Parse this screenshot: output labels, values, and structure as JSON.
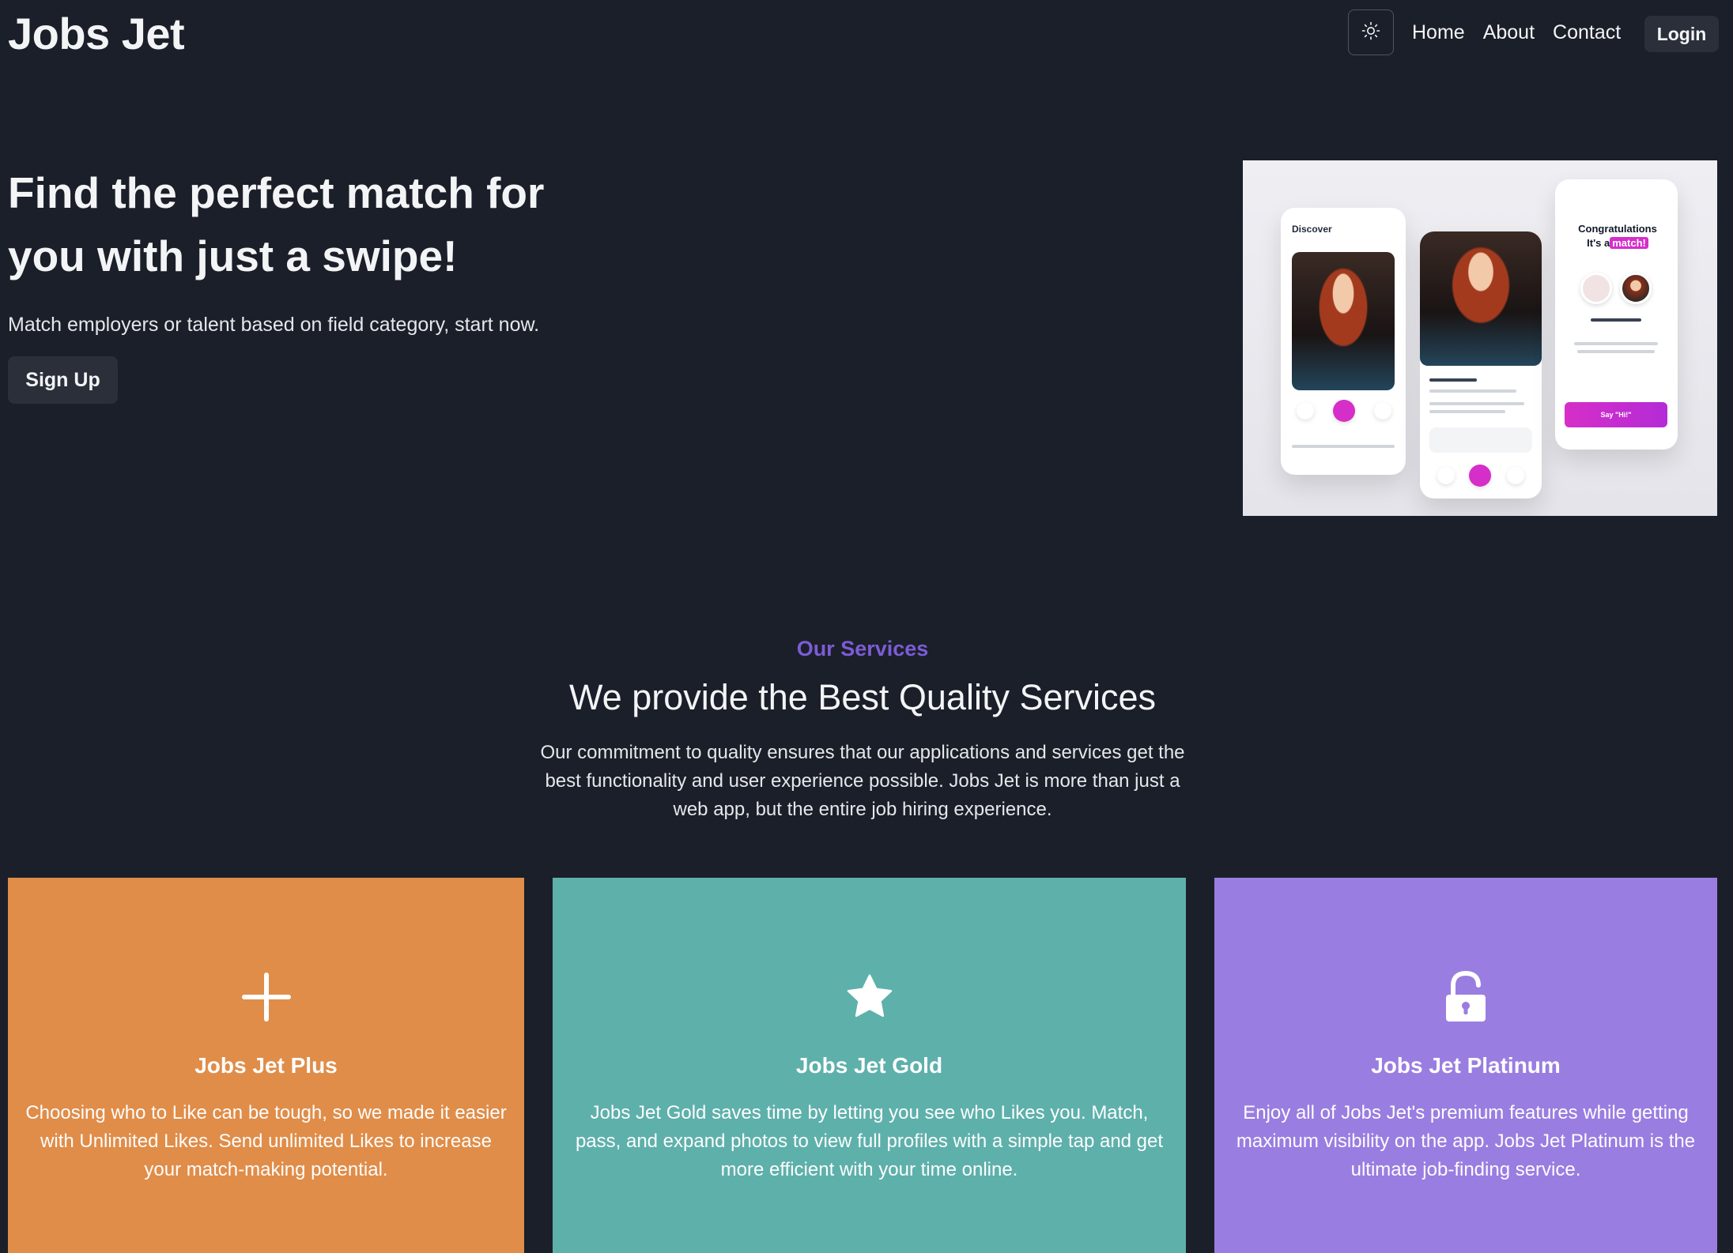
{
  "header": {
    "brand": "Jobs Jet",
    "theme_toggle_icon": "sun-icon",
    "nav": [
      {
        "label": "Home"
      },
      {
        "label": "About"
      },
      {
        "label": "Contact"
      }
    ],
    "login_label": "Login"
  },
  "hero": {
    "title": "Find the perfect match for you with just a swipe!",
    "subtitle": "Match employers or talent based on field category, start now.",
    "signup_label": "Sign Up",
    "image": {
      "phone1_heading": "Discover",
      "congrats_line1": "Congratulations",
      "congrats_line2_prefix": "It's a",
      "congrats_match": "match!",
      "say_hi": "Say \"Hi!\"",
      "accent_color": "#d62ec9"
    }
  },
  "services": {
    "eyebrow": "Our Services",
    "title": "We provide the Best Quality Services",
    "description": "Our commitment to quality ensures that our applications and services get the best functionality and user experience possible. Jobs Jet is more than just a web app, but the entire job hiring experience.",
    "cards": [
      {
        "title": "Jobs Jet Plus",
        "icon": "plus-icon",
        "color": "#e08d49",
        "description": "Choosing who to Like can be tough, so we made it easier with Unlimited Likes. Send unlimited Likes to increase your match-making potential."
      },
      {
        "title": "Jobs Jet Gold",
        "icon": "star-icon",
        "color": "#5eb0ab",
        "description": "Jobs Jet Gold saves time by letting you see who Likes you. Match, pass, and expand photos to view full profiles with a simple tap and get more efficient with your time online."
      },
      {
        "title": "Jobs Jet Platinum",
        "icon": "unlock-icon",
        "color": "#9a7de1",
        "description": "Enjoy all of Jobs Jet's premium features while getting maximum visibility on the app. Jobs Jet Platinum is the ultimate job-finding service."
      }
    ]
  },
  "colors": {
    "background": "#1b1f29",
    "accent": "#7c5cd6",
    "button_bg": "#2a2f3a"
  }
}
